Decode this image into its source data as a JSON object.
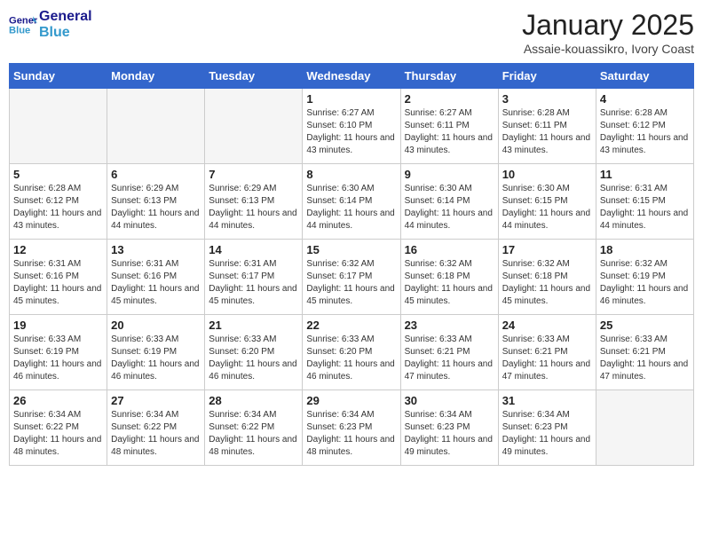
{
  "header": {
    "logo_line1": "General",
    "logo_line2": "Blue",
    "month_title": "January 2025",
    "location": "Assaie-kouassikro, Ivory Coast"
  },
  "days_of_week": [
    "Sunday",
    "Monday",
    "Tuesday",
    "Wednesday",
    "Thursday",
    "Friday",
    "Saturday"
  ],
  "weeks": [
    [
      {
        "day": "",
        "info": ""
      },
      {
        "day": "",
        "info": ""
      },
      {
        "day": "",
        "info": ""
      },
      {
        "day": "1",
        "info": "Sunrise: 6:27 AM\nSunset: 6:10 PM\nDaylight: 11 hours and 43 minutes."
      },
      {
        "day": "2",
        "info": "Sunrise: 6:27 AM\nSunset: 6:11 PM\nDaylight: 11 hours and 43 minutes."
      },
      {
        "day": "3",
        "info": "Sunrise: 6:28 AM\nSunset: 6:11 PM\nDaylight: 11 hours and 43 minutes."
      },
      {
        "day": "4",
        "info": "Sunrise: 6:28 AM\nSunset: 6:12 PM\nDaylight: 11 hours and 43 minutes."
      }
    ],
    [
      {
        "day": "5",
        "info": "Sunrise: 6:28 AM\nSunset: 6:12 PM\nDaylight: 11 hours and 43 minutes."
      },
      {
        "day": "6",
        "info": "Sunrise: 6:29 AM\nSunset: 6:13 PM\nDaylight: 11 hours and 44 minutes."
      },
      {
        "day": "7",
        "info": "Sunrise: 6:29 AM\nSunset: 6:13 PM\nDaylight: 11 hours and 44 minutes."
      },
      {
        "day": "8",
        "info": "Sunrise: 6:30 AM\nSunset: 6:14 PM\nDaylight: 11 hours and 44 minutes."
      },
      {
        "day": "9",
        "info": "Sunrise: 6:30 AM\nSunset: 6:14 PM\nDaylight: 11 hours and 44 minutes."
      },
      {
        "day": "10",
        "info": "Sunrise: 6:30 AM\nSunset: 6:15 PM\nDaylight: 11 hours and 44 minutes."
      },
      {
        "day": "11",
        "info": "Sunrise: 6:31 AM\nSunset: 6:15 PM\nDaylight: 11 hours and 44 minutes."
      }
    ],
    [
      {
        "day": "12",
        "info": "Sunrise: 6:31 AM\nSunset: 6:16 PM\nDaylight: 11 hours and 45 minutes."
      },
      {
        "day": "13",
        "info": "Sunrise: 6:31 AM\nSunset: 6:16 PM\nDaylight: 11 hours and 45 minutes."
      },
      {
        "day": "14",
        "info": "Sunrise: 6:31 AM\nSunset: 6:17 PM\nDaylight: 11 hours and 45 minutes."
      },
      {
        "day": "15",
        "info": "Sunrise: 6:32 AM\nSunset: 6:17 PM\nDaylight: 11 hours and 45 minutes."
      },
      {
        "day": "16",
        "info": "Sunrise: 6:32 AM\nSunset: 6:18 PM\nDaylight: 11 hours and 45 minutes."
      },
      {
        "day": "17",
        "info": "Sunrise: 6:32 AM\nSunset: 6:18 PM\nDaylight: 11 hours and 45 minutes."
      },
      {
        "day": "18",
        "info": "Sunrise: 6:32 AM\nSunset: 6:19 PM\nDaylight: 11 hours and 46 minutes."
      }
    ],
    [
      {
        "day": "19",
        "info": "Sunrise: 6:33 AM\nSunset: 6:19 PM\nDaylight: 11 hours and 46 minutes."
      },
      {
        "day": "20",
        "info": "Sunrise: 6:33 AM\nSunset: 6:19 PM\nDaylight: 11 hours and 46 minutes."
      },
      {
        "day": "21",
        "info": "Sunrise: 6:33 AM\nSunset: 6:20 PM\nDaylight: 11 hours and 46 minutes."
      },
      {
        "day": "22",
        "info": "Sunrise: 6:33 AM\nSunset: 6:20 PM\nDaylight: 11 hours and 46 minutes."
      },
      {
        "day": "23",
        "info": "Sunrise: 6:33 AM\nSunset: 6:21 PM\nDaylight: 11 hours and 47 minutes."
      },
      {
        "day": "24",
        "info": "Sunrise: 6:33 AM\nSunset: 6:21 PM\nDaylight: 11 hours and 47 minutes."
      },
      {
        "day": "25",
        "info": "Sunrise: 6:33 AM\nSunset: 6:21 PM\nDaylight: 11 hours and 47 minutes."
      }
    ],
    [
      {
        "day": "26",
        "info": "Sunrise: 6:34 AM\nSunset: 6:22 PM\nDaylight: 11 hours and 48 minutes."
      },
      {
        "day": "27",
        "info": "Sunrise: 6:34 AM\nSunset: 6:22 PM\nDaylight: 11 hours and 48 minutes."
      },
      {
        "day": "28",
        "info": "Sunrise: 6:34 AM\nSunset: 6:22 PM\nDaylight: 11 hours and 48 minutes."
      },
      {
        "day": "29",
        "info": "Sunrise: 6:34 AM\nSunset: 6:23 PM\nDaylight: 11 hours and 48 minutes."
      },
      {
        "day": "30",
        "info": "Sunrise: 6:34 AM\nSunset: 6:23 PM\nDaylight: 11 hours and 49 minutes."
      },
      {
        "day": "31",
        "info": "Sunrise: 6:34 AM\nSunset: 6:23 PM\nDaylight: 11 hours and 49 minutes."
      },
      {
        "day": "",
        "info": ""
      }
    ]
  ]
}
